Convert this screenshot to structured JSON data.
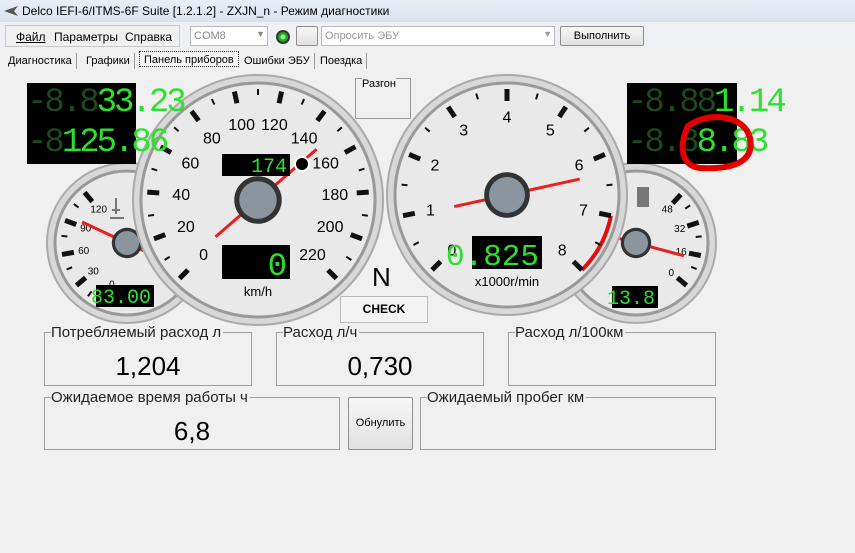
{
  "window": {
    "title": "Delco IEFI-6/ITMS-6F Suite [1.2.1.2] - ZXJN_n - Режим диагностики"
  },
  "menu": [
    "Файл",
    "Параметры",
    "Справка"
  ],
  "toolbar": {
    "port": "COM8",
    "query_placeholder": "Опросить ЭБУ",
    "execute_label": "Выполнить",
    "status_color": "#22aa22"
  },
  "tabs": [
    {
      "label": "Диагностика"
    },
    {
      "label": "Графики"
    },
    {
      "label": "Панель приборов",
      "active": true
    },
    {
      "label": "Ошибки ЭБУ"
    },
    {
      "label": "Поездка"
    }
  ],
  "dashboard": {
    "lcd_left": {
      "top": "33.23",
      "bottom": "125.86"
    },
    "lcd_right": {
      "top": "1.14",
      "bottom": "8.83"
    },
    "razgon_label": "Разгон",
    "gear": "N",
    "check_label": "CHECK",
    "speedometer": {
      "ticks": [
        "0",
        "20",
        "40",
        "60",
        "80",
        "100",
        "120",
        "140",
        "160",
        "180",
        "200",
        "220"
      ],
      "min": 0,
      "max": 220,
      "needle": 150,
      "unit": "km/h",
      "odometer": "174",
      "digital": "0"
    },
    "tachometer": {
      "ticks": [
        "0",
        "1",
        "2",
        "3",
        "4",
        "5",
        "6",
        "7",
        "8"
      ],
      "min": 0,
      "max": 8,
      "needle": 6.3,
      "unit": "x1000r/min",
      "digital": "0.825",
      "redline_from": 7
    },
    "temperature": {
      "ticks": [
        "0",
        "30",
        "60",
        "90",
        "120"
      ],
      "min": 0,
      "max": 130,
      "needle": 95,
      "digital": "83.00",
      "icon": "coolant-temp-icon"
    },
    "fuel": {
      "ticks": [
        "0",
        "16",
        "32",
        "48"
      ],
      "min": 0,
      "max": 55,
      "needle": 13.8,
      "digital": "13.8",
      "icon": "fuel-pump-icon"
    },
    "highlight_color": "#e00000"
  },
  "panels": {
    "consumed": {
      "label": "Потребляемый расход л",
      "value": "1,204"
    },
    "rate_h": {
      "label": "Расход л/ч",
      "value": "0,730"
    },
    "rate_100": {
      "label": "Расход л/100км",
      "value": ""
    },
    "runtime": {
      "label": "Ожидаемое время работы ч",
      "value": "6,8"
    },
    "reset_label": "Обнулить",
    "range": {
      "label": "Ожидаемый пробег км",
      "value": ""
    }
  }
}
